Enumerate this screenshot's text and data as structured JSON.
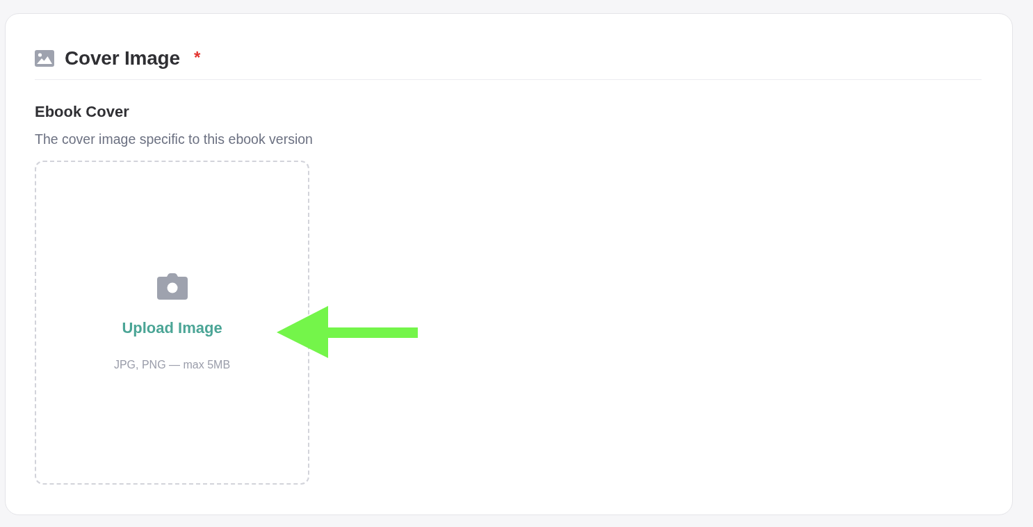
{
  "section": {
    "title": "Cover Image",
    "required_mark": "*"
  },
  "field": {
    "label": "Ebook Cover",
    "description": "The cover image specific to this ebook version",
    "upload": {
      "action": "Upload Image",
      "hint": "JPG, PNG — max 5MB"
    }
  },
  "annotations": [
    {
      "kind": "arrow"
    }
  ]
}
